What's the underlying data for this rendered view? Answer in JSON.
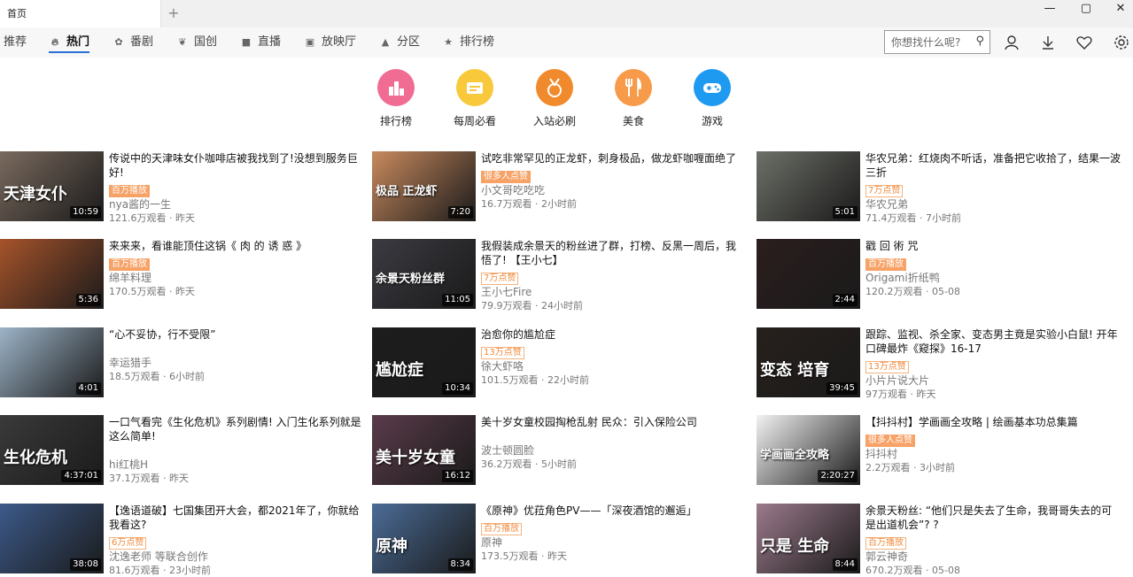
{
  "window": {
    "tab_title": "首页",
    "new_tab": "+",
    "minimize": "—",
    "maximize": "▢",
    "close": "✕"
  },
  "nav": {
    "items": [
      {
        "label": "推荐",
        "icon": ""
      },
      {
        "label": "热门",
        "icon": "flame-icon"
      },
      {
        "label": "番剧",
        "icon": "paw-icon"
      },
      {
        "label": "国创",
        "icon": "leaf-icon"
      },
      {
        "label": "直播",
        "icon": "camera-icon"
      },
      {
        "label": "放映厅",
        "icon": "film-icon"
      },
      {
        "label": "分区",
        "icon": "cubes-icon"
      },
      {
        "label": "排行榜",
        "icon": "trophy-icon"
      }
    ],
    "active": "热门",
    "search_placeholder": "你想找什么呢?"
  },
  "categories": [
    {
      "label": "排行榜",
      "color": "#f06c93",
      "icon": "chart-icon"
    },
    {
      "label": "每周必看",
      "color": "#f8c93b",
      "icon": "ticket-icon"
    },
    {
      "label": "入站必刷",
      "color": "#f08a2c",
      "icon": "medal-icon"
    },
    {
      "label": "美食",
      "color": "#f79a4a",
      "icon": "cutlery-icon"
    },
    {
      "label": "游戏",
      "color": "#1e9af0",
      "icon": "gamepad-icon"
    }
  ],
  "videos": [
    {
      "title": "传说中的天津味女仆咖啡店被我找到了!没想到服务巨好!",
      "badge": "百万播放",
      "badge_style": "fill",
      "author": "nya酱的一生",
      "views": "121.6万观看",
      "time": "昨天",
      "duration": "10:59",
      "thumb_text": "天津女仆",
      "thumb_bg": "#7a6a5e"
    },
    {
      "title": "试吃非常罕见的正龙虾，刺身极品，做龙虾咖喱面绝了",
      "badge": "很多人点赞",
      "badge_style": "fill",
      "author": "小文哥吃吃吃",
      "views": "16.7万观看",
      "time": "2小时前",
      "duration": "7:20",
      "thumb_text": "极品 正龙虾",
      "thumb_bg": "#c98a5e"
    },
    {
      "title": "华农兄弟：红烧肉不听话，准备把它收拾了，结果一波三折",
      "badge": "7万点赞",
      "badge_style": "outline",
      "author": "华农兄弟",
      "views": "71.4万观看",
      "time": "7小时前",
      "duration": "5:01",
      "thumb_text": "",
      "thumb_bg": "#6d7068"
    },
    {
      "title": "来来来，看谁能顶住这锅《 肉 的 诱 惑 》",
      "badge": "百万播放",
      "badge_style": "fill",
      "author": "绵羊料理",
      "views": "170.5万观看",
      "time": "昨天",
      "duration": "5:36",
      "thumb_text": "",
      "thumb_bg": "#a6532a"
    },
    {
      "title": "我假装成余景天的粉丝进了群，打榜、反黑一周后，我悟了! 【王小七】",
      "badge": "7万点赞",
      "badge_style": "outline",
      "author": "王小七Fire",
      "views": "79.9万观看",
      "time": "24小时前",
      "duration": "11:05",
      "thumb_text": "余景天粉丝群",
      "thumb_bg": "#3b3b42"
    },
    {
      "title": "戳 回 術 咒",
      "badge": "百万播放",
      "badge_style": "fill",
      "author": "Origami折纸鸭",
      "views": "120.2万观看",
      "time": "05-08",
      "duration": "2:44",
      "thumb_text": "",
      "thumb_bg": "#2b1e1e"
    },
    {
      "title": "“心不妥协，行不受限”",
      "badge": "",
      "badge_style": "",
      "author": "幸运猎手",
      "views": "18.5万观看",
      "time": "6小时前",
      "duration": "4:01",
      "thumb_text": "",
      "thumb_bg": "#9db4c8"
    },
    {
      "title": "治愈你的尴尬症",
      "badge": "13万点赞",
      "badge_style": "outline",
      "author": "徐大虾咯",
      "views": "101.5万观看",
      "time": "22小时前",
      "duration": "10:34",
      "thumb_text": "尴尬症",
      "thumb_bg": "#1d1d1d"
    },
    {
      "title": "跟踪、监视、杀全家、变态男主竟是实验小白鼠! 开年口碑最炸《窥探》16-17",
      "badge": "13万点赞",
      "badge_style": "outline",
      "author": "小片片说大片",
      "views": "97万观看",
      "time": "昨天",
      "duration": "39:45",
      "thumb_text": "变态 培育",
      "thumb_bg": "#27201c"
    },
    {
      "title": "一口气看完《生化危机》系列剧情! 入门生化系列就是这么简单!",
      "badge": "",
      "badge_style": "",
      "author": "hi红桃H",
      "views": "37.1万观看",
      "time": "昨天",
      "duration": "4:37:01",
      "thumb_text": "生化危机",
      "thumb_bg": "#3a3a3a"
    },
    {
      "title": "美十岁女童校园掏枪乱射 民众：引入保险公司",
      "badge": "",
      "badge_style": "",
      "author": "波士顿圆脸",
      "views": "36.2万观看",
      "time": "5小时前",
      "duration": "16:12",
      "thumb_text": "美十岁女童",
      "thumb_bg": "#5a3b4a"
    },
    {
      "title": "【抖抖村】学画画全攻略 | 绘画基本功总集篇",
      "badge": "很多人点赞",
      "badge_style": "fill",
      "author": "抖抖村",
      "views": "2.2万观看",
      "time": "3小时前",
      "duration": "2:20:27",
      "thumb_text": "学画画全攻略",
      "thumb_bg": "#f2f2f2"
    },
    {
      "title": "【逸语道破】七国集团开大会，都2021年了，你就给我看这?",
      "badge": "6万点赞",
      "badge_style": "outline",
      "author": "沈逸老师 等联合创作",
      "views": "81.6万观看",
      "time": "23小时前",
      "duration": "38:08",
      "thumb_text": "",
      "thumb_bg": "#3c5a8a"
    },
    {
      "title": "《原神》优菈角色PV——「深夜酒馆的邂逅」",
      "badge": "百万播放",
      "badge_style": "outline",
      "author": "原神",
      "views": "173.5万观看",
      "time": "昨天",
      "duration": "8:34",
      "thumb_text": "原神",
      "thumb_bg": "#4b6c97"
    },
    {
      "title": "余景天粉丝: “他们只是失去了生命，我哥哥失去的可是出道机会”? ?",
      "badge": "百万播放",
      "badge_style": "outline",
      "author": "郭云神奇",
      "views": "670.2万观看",
      "time": "05-08",
      "duration": "8:44",
      "thumb_text": "只是 生命",
      "thumb_bg": "#9b7a8c"
    }
  ]
}
